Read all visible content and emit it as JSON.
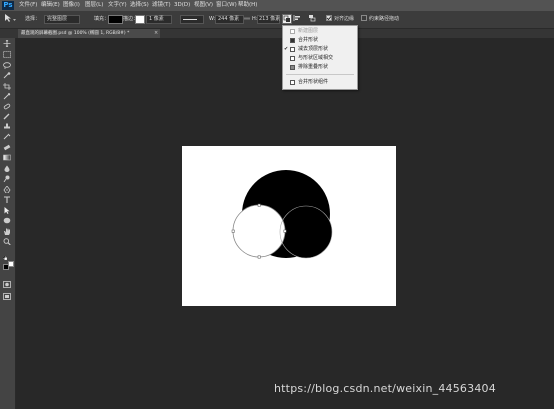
{
  "app": {
    "logo": "Ps"
  },
  "menu": [
    "文件(F)",
    "编辑(E)",
    "图像(I)",
    "图层(L)",
    "文字(Y)",
    "选择(S)",
    "滤镜(T)",
    "3D(D)",
    "视图(V)",
    "窗口(W)",
    "帮助(H)"
  ],
  "options": {
    "mode_label": "选择：",
    "mode_value": "完整图层",
    "fill_label": "填充：",
    "stroke_label": "描边：",
    "stroke_width": "1 像素",
    "w_label": "W:",
    "w_value": "244 像素",
    "h_label": "H:",
    "h_value": "213 像素",
    "align_edges_label": "对齐边缘",
    "constrain_label": "约束路径拖动"
  },
  "tab": {
    "title": "最直观的屏幕截图.psd @ 100% (椭圆 1, RGB/8#) *",
    "close": "×"
  },
  "path_ops_menu": [
    {
      "label": "新建图层",
      "checked": false,
      "disabled": true
    },
    {
      "label": "合并形状",
      "checked": false,
      "disabled": false
    },
    {
      "label": "减去顶层形状",
      "checked": true,
      "disabled": false
    },
    {
      "label": "与形状区域相交",
      "checked": false,
      "disabled": false
    },
    {
      "label": "排除重叠形状",
      "checked": false,
      "disabled": false
    },
    {
      "label": "合并形状组件",
      "checked": false,
      "disabled": false
    }
  ],
  "watermark": "https://blog.csdn.net/weixin_44563404",
  "colors": {
    "menubar": "#535353",
    "optbar": "#3c3c3c",
    "workspace": "#282828",
    "canvas": "#ffffff"
  }
}
